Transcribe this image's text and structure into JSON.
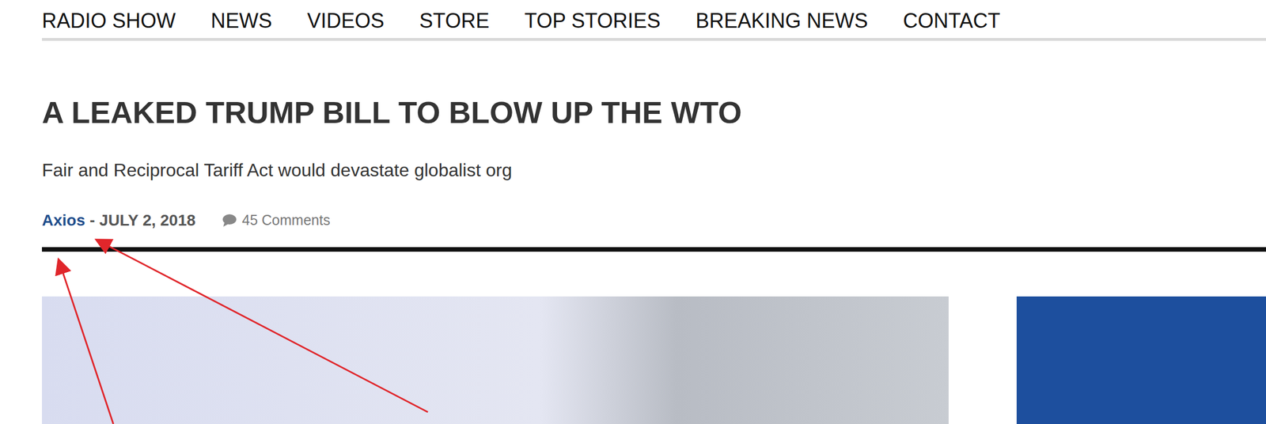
{
  "nav": {
    "items": [
      {
        "label": "RADIO SHOW"
      },
      {
        "label": "NEWS"
      },
      {
        "label": "VIDEOS"
      },
      {
        "label": "STORE"
      },
      {
        "label": "TOP STORIES"
      },
      {
        "label": "BREAKING NEWS"
      },
      {
        "label": "CONTACT"
      }
    ]
  },
  "article": {
    "title": "A LEAKED TRUMP BILL TO BLOW UP THE WTO",
    "subtitle": "Fair and Reciprocal Tariff Act would devastate globalist org",
    "source": "Axios",
    "date": "- JULY 2, 2018",
    "comments": "45 Comments"
  }
}
